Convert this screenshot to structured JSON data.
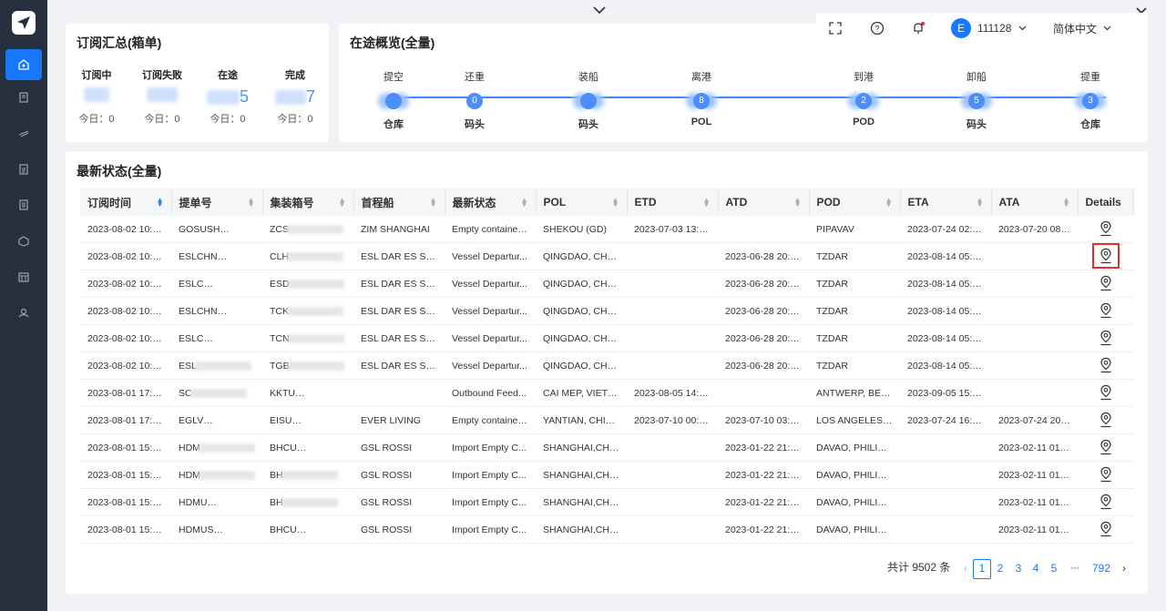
{
  "sidebar": {
    "logo_icon": "paper-plane-icon",
    "items": [
      {
        "icon": "dashboard-icon",
        "active": true
      },
      {
        "icon": "orders-icon"
      },
      {
        "icon": "ship-icon"
      },
      {
        "icon": "document-icon"
      },
      {
        "icon": "list-icon"
      },
      {
        "icon": "container-icon"
      },
      {
        "icon": "calendar-icon"
      },
      {
        "icon": "settings-icon"
      }
    ]
  },
  "header": {
    "user_initial": "E",
    "user_name": "111128",
    "language": "简体中文"
  },
  "subscription_summary": {
    "title": "订阅汇总(箱单)",
    "columns": [
      {
        "label": "订阅中",
        "today": "今日：0"
      },
      {
        "label": "订阅失败",
        "today": "今日：0"
      },
      {
        "label": "在途",
        "value_suffix": "5",
        "today": "今日：0"
      },
      {
        "label": "完成",
        "value_suffix": "7",
        "today": "今日：0"
      }
    ]
  },
  "transit_overview": {
    "title": "在途概览(全量)",
    "stages": [
      {
        "top": "提空",
        "value": "",
        "bottom": "仓库"
      },
      {
        "top": "还重",
        "value": "0",
        "bottom": "码头"
      },
      {
        "top": "装船",
        "value": "",
        "bottom": "码头"
      },
      {
        "top": "离港",
        "value": "8",
        "bottom": "POL"
      },
      {
        "top": "到港",
        "value": "2",
        "bottom": "POD"
      },
      {
        "top": "卸船",
        "value": "5",
        "bottom": "码头"
      },
      {
        "top": "提重",
        "value": "3",
        "bottom": "仓库"
      }
    ]
  },
  "latest_status": {
    "title": "最新状态(全量)",
    "columns": [
      "订阅时间",
      "提单号",
      "集装箱号",
      "首程船",
      "最新状态",
      "POL",
      "ETD",
      "ATD",
      "POD",
      "ETA",
      "ATA",
      "Details"
    ],
    "rows": [
      [
        "2023-08-02 10:4...",
        "GOSUSH",
        "ZCS",
        "ZIM SHANGHAI",
        "Empty container...",
        "SHEKOU (GD)",
        "2023-07-03 13:0...",
        "",
        "PIPAVAV",
        "2023-07-24 02:3...",
        "2023-07-20 08:3..."
      ],
      [
        "2023-08-02 10:3...",
        "ESLCHN",
        "CLH",
        "ESL DAR ES SAL...",
        "Vessel Departur...",
        "QINGDAO, CHINA",
        "",
        "2023-06-28 20:0...",
        "TZDAR",
        "2023-08-14 05:0...",
        ""
      ],
      [
        "2023-08-02 10:3...",
        "ESLC",
        "ESD",
        "ESL DAR ES SAL...",
        "Vessel Departur...",
        "QINGDAO, CHINA",
        "",
        "2023-06-28 20:0...",
        "TZDAR",
        "2023-08-14 05:0...",
        ""
      ],
      [
        "2023-08-02 10:3...",
        "ESLCHN",
        "TCK",
        "ESL DAR ES SAL...",
        "Vessel Departur...",
        "QINGDAO, CHINA",
        "",
        "2023-06-28 20:0...",
        "TZDAR",
        "2023-08-14 05:0...",
        ""
      ],
      [
        "2023-08-02 10:3...",
        "ESLC",
        "TCN",
        "ESL DAR ES SAL...",
        "Vessel Departur...",
        "QINGDAO, CHINA",
        "",
        "2023-06-28 20:0...",
        "TZDAR",
        "2023-08-14 05:0...",
        ""
      ],
      [
        "2023-08-02 10:3...",
        "ESL",
        "TGB",
        "ESL DAR ES SAL...",
        "Vessel Departur...",
        "QINGDAO, CHINA",
        "",
        "2023-06-28 20:0...",
        "TZDAR",
        "2023-08-14 05:0...",
        ""
      ],
      [
        "2023-08-01 17:4...",
        "SC",
        "KKTU",
        "",
        "Outbound Feed...",
        "CAI MEP, VIETN...",
        "2023-08-05 14:0...",
        "",
        "ANTWERP, BELGI...",
        "2023-09-05 15:3...",
        ""
      ],
      [
        "2023-08-01 17:3...",
        "EGLV",
        "EISU",
        "EVER LIVING",
        "Empty container...",
        "YANTIAN, CHIN...",
        "2023-07-10 00:0...",
        "2023-07-10 03:4...",
        "LOS ANGELES, C...",
        "2023-07-24 16:0...",
        "2023-07-24 20:3..."
      ],
      [
        "2023-08-01 15:5...",
        "HDM",
        "BHCU",
        "GSL ROSSI",
        "Import Empty C...",
        "SHANGHAI,CHI...",
        "",
        "2023-01-22 21:3...",
        "DAVAO, PHILIPPI...",
        "",
        "2023-02-11 01:4..."
      ],
      [
        "2023-08-01 15:5...",
        "HDM",
        "BH",
        "GSL ROSSI",
        "Import Empty C...",
        "SHANGHAI,CHI...",
        "",
        "2023-01-22 21:3...",
        "DAVAO, PHILIPPI...",
        "",
        "2023-02-11 01:4..."
      ],
      [
        "2023-08-01 15:5...",
        "HDMU",
        "BH",
        "GSL ROSSI",
        "Import Empty C...",
        "SHANGHAI,CHI...",
        "",
        "2023-01-22 21:3...",
        "DAVAO, PHILIPPI...",
        "",
        "2023-02-11 01:4..."
      ],
      [
        "2023-08-01 15:5...",
        "HDMUS",
        "BHCU",
        "GSL ROSSI",
        "Import Empty C...",
        "SHANGHAI,CHI...",
        "",
        "2023-01-22 21:3...",
        "DAVAO, PHILIPPI...",
        "",
        "2023-02-11 01:4..."
      ]
    ],
    "highlighted_row": 1
  },
  "pagination": {
    "total": "共计 9502 条",
    "pages": [
      "1",
      "2",
      "3",
      "4",
      "5"
    ],
    "ellipsis": "•••",
    "last": "792",
    "current": "1"
  }
}
